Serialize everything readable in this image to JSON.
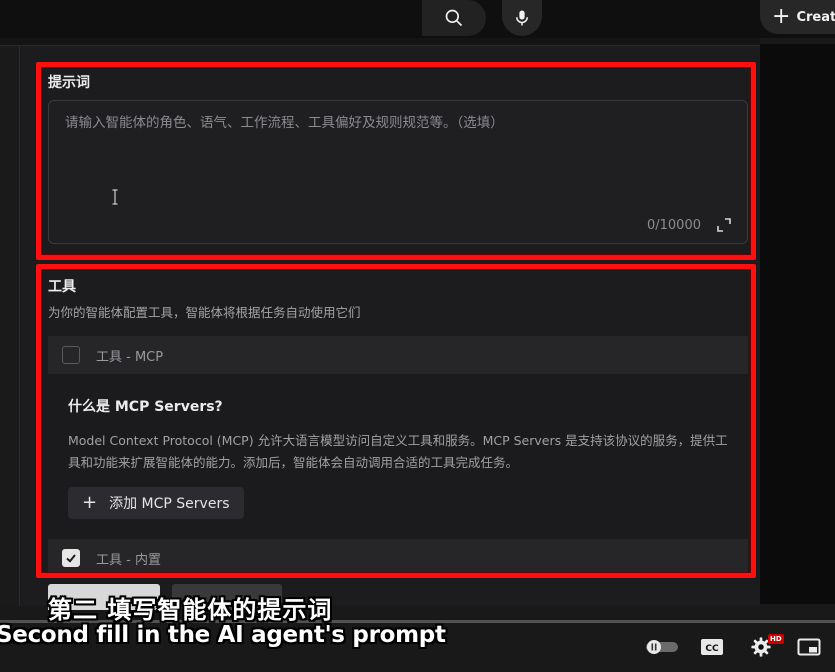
{
  "topbar": {
    "search_icon": "search-icon",
    "mic_icon": "mic-icon",
    "create_label": "Create"
  },
  "prompt_section": {
    "title": "提示词",
    "placeholder": "请输入智能体的角色、语气、工作流程、工具偏好及规则规范等。（选填）",
    "counter": "0/10000"
  },
  "tools_section": {
    "title": "工具",
    "subtitle": "为你的智能体配置工具，智能体将根据任务自动使用它们",
    "mcp_row_label": "工具 - MCP",
    "mcp_row_checked": false,
    "mcp_card": {
      "title": "什么是 MCP Servers?",
      "description": "Model Context Protocol (MCP) 允许大语言模型访问自定义工具和服务。MCP Servers 是支持该协议的服务，提供工具和功能来扩展智能体的能力。添加后，智能体会自动调用合适的工具完成任务。",
      "add_button": "添加 MCP Servers"
    },
    "builtin_row_label": "工具 - 内置",
    "builtin_row_checked": true
  },
  "subtitles": {
    "chinese": "第二 填写智能体的提示词",
    "english": "Second fill in the AI agent's prompt"
  },
  "player": {
    "cc_label": "CC",
    "hd_badge": "HD"
  },
  "colors": {
    "highlight": "#ff1010",
    "panel_bg": "#1c1c1e"
  }
}
